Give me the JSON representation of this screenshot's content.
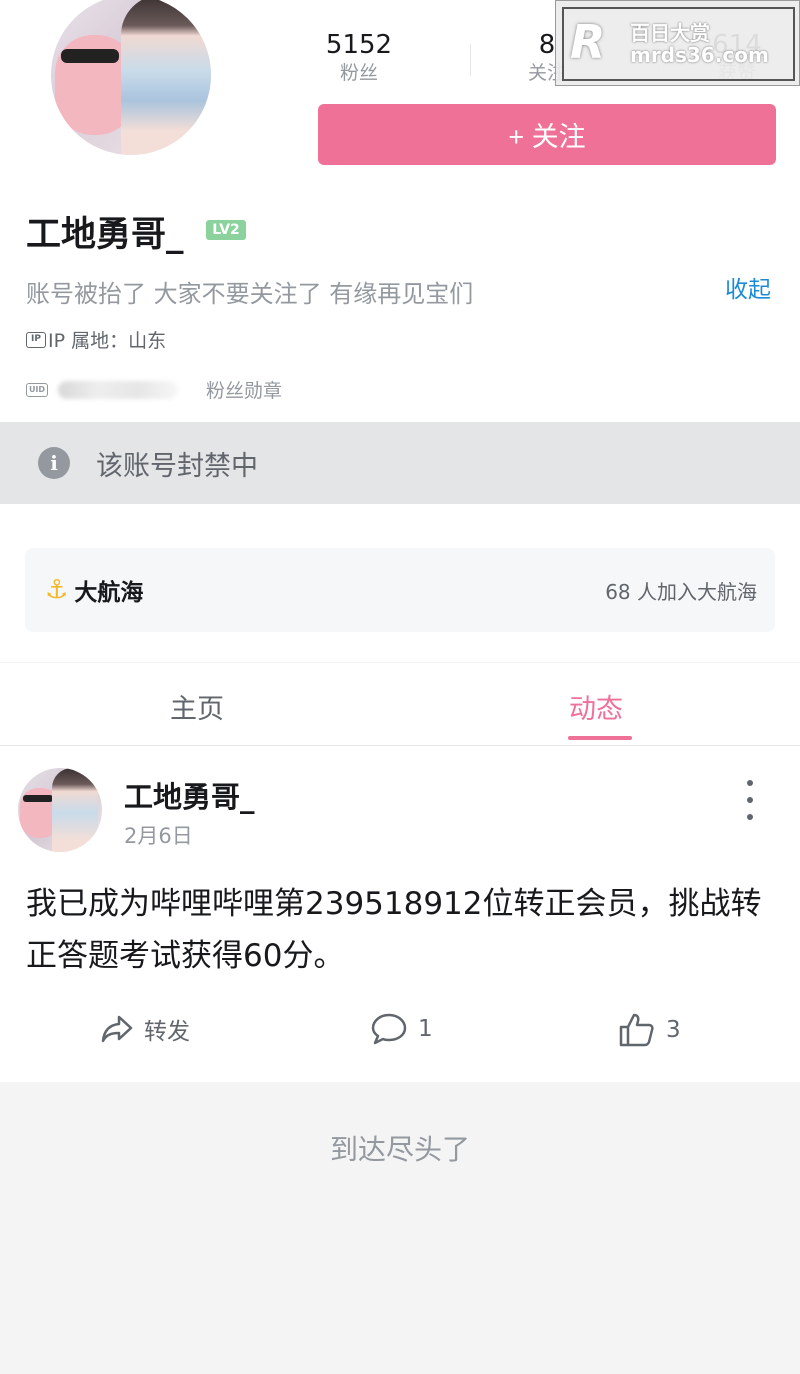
{
  "profile": {
    "stats": [
      {
        "value": "5152",
        "label": "粉丝"
      },
      {
        "value": "8",
        "label": "关注"
      },
      {
        "value": "614",
        "label": "获赞"
      }
    ],
    "follow_label": "+ 关注",
    "username": "工地勇哥_",
    "level": "LV2",
    "bio": "账号被抬了 大家不要关注了 有缘再见宝们",
    "collapse_label": "收起",
    "ip_icon": "IP",
    "ip_location": "IP 属地：山东",
    "uid_icon": "UID",
    "medal_label": "粉丝勋章"
  },
  "watermark": {
    "logo": "R",
    "line1": "百日大赏",
    "line2": "mrds36.com"
  },
  "banned": {
    "icon": "i",
    "text": "该账号封禁中"
  },
  "fleet": {
    "icon": "⚓",
    "title": "大航海",
    "count_text": "68 人加入大航海"
  },
  "tabs": [
    {
      "label": "主页",
      "active": false
    },
    {
      "label": "动态",
      "active": true
    }
  ],
  "post": {
    "author": "工地勇哥_",
    "date": "2月6日",
    "text": "我已成为哔哩哔哩第239518912位转正会员，挑战转正答题考试获得60分。",
    "share_label": "转发",
    "comment_count": "1",
    "like_count": "3"
  },
  "footer": {
    "end_text": "到达尽头了"
  },
  "colors": {
    "accent": "#f07198",
    "link": "#1b8bd8",
    "level": "#8bd29d",
    "anchor": "#f5b727"
  }
}
